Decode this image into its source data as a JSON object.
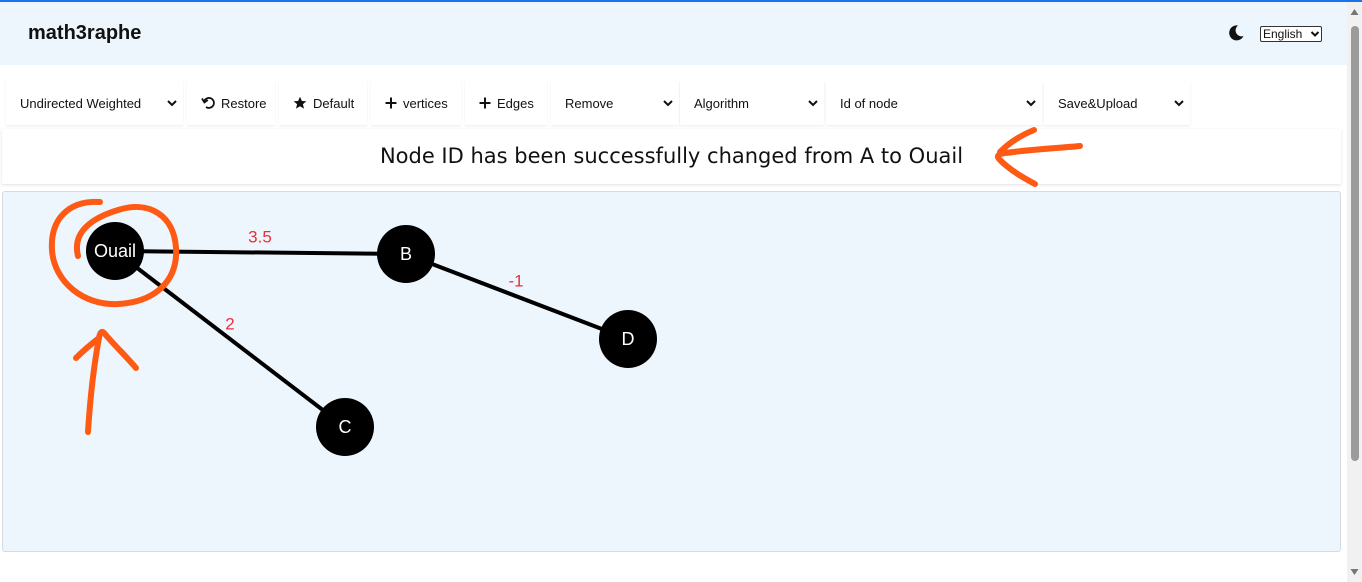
{
  "header": {
    "title": "math3raphe",
    "language": "English"
  },
  "toolbar": {
    "graph_type": "Undirected Weighted",
    "restore_label": "Restore",
    "default_label": "Default",
    "vertices_label": "vertices",
    "edges_label": "Edges",
    "remove_label": "Remove",
    "algorithm_label": "Algorithm",
    "node_id_label": "Id of node",
    "save_label": "Save&Upload"
  },
  "status": {
    "message": "Node ID has been successfully changed from A to Ouail"
  },
  "graph": {
    "nodes": [
      {
        "id": "Ouail"
      },
      {
        "id": "B"
      },
      {
        "id": "C"
      },
      {
        "id": "D"
      }
    ],
    "edges": [
      {
        "from": "Ouail",
        "to": "B",
        "weight": "3.5"
      },
      {
        "from": "B",
        "to": "D",
        "weight": "-1"
      },
      {
        "from": "Ouail",
        "to": "C",
        "weight": "2"
      }
    ]
  },
  "colors": {
    "accent": "#1a73e8",
    "node_fill": "#000000",
    "node_text": "#ffffff",
    "edge": "#000000",
    "weight_label": "#e8313a",
    "annotation": "#ff5a14",
    "canvas_bg": "#eef6fd"
  }
}
